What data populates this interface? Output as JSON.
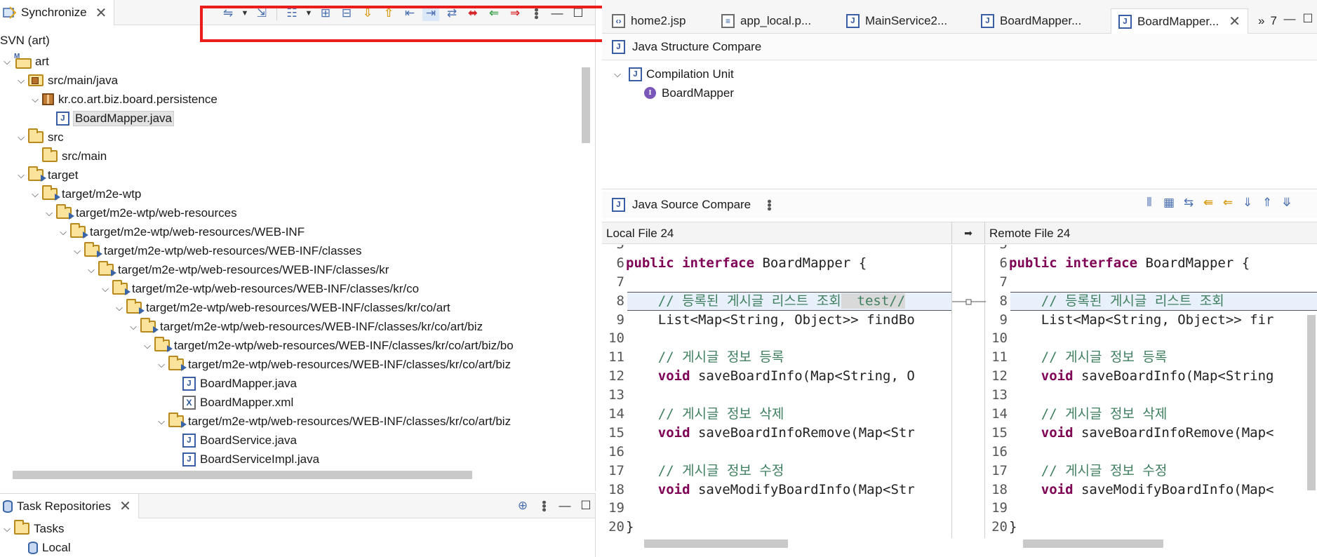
{
  "sync": {
    "tab_label": "Synchronize",
    "tree_title": "SVN (art)",
    "tree": [
      {
        "label": "art",
        "icon": "project-icon",
        "indent": 0,
        "expanded": true
      },
      {
        "label": "src/main/java",
        "icon": "package-folder-icon",
        "indent": 1,
        "expanded": true
      },
      {
        "label": "kr.co.art.biz.board.persistence",
        "icon": "package-icon",
        "indent": 2,
        "expanded": true
      },
      {
        "label": "BoardMapper.java",
        "icon": "java-file-icon",
        "indent": 3,
        "expanded": null,
        "selected": true
      },
      {
        "label": "src",
        "icon": "folder-icon",
        "indent": 1,
        "expanded": true
      },
      {
        "label": "src/main",
        "icon": "folder-icon",
        "indent": 2,
        "expanded": null
      },
      {
        "label": "target",
        "icon": "folder-outgoing-icon",
        "indent": 1,
        "expanded": true
      },
      {
        "label": "target/m2e-wtp",
        "icon": "folder-outgoing-icon",
        "indent": 2,
        "expanded": true
      },
      {
        "label": "target/m2e-wtp/web-resources",
        "icon": "folder-outgoing-icon",
        "indent": 3,
        "expanded": true
      },
      {
        "label": "target/m2e-wtp/web-resources/WEB-INF",
        "icon": "folder-outgoing-icon",
        "indent": 4,
        "expanded": true
      },
      {
        "label": "target/m2e-wtp/web-resources/WEB-INF/classes",
        "icon": "folder-outgoing-icon",
        "indent": 5,
        "expanded": true
      },
      {
        "label": "target/m2e-wtp/web-resources/WEB-INF/classes/kr",
        "icon": "folder-outgoing-icon",
        "indent": 6,
        "expanded": true
      },
      {
        "label": "target/m2e-wtp/web-resources/WEB-INF/classes/kr/co",
        "icon": "folder-outgoing-icon",
        "indent": 7,
        "expanded": true
      },
      {
        "label": "target/m2e-wtp/web-resources/WEB-INF/classes/kr/co/art",
        "icon": "folder-outgoing-icon",
        "indent": 8,
        "expanded": true
      },
      {
        "label": "target/m2e-wtp/web-resources/WEB-INF/classes/kr/co/art/biz",
        "icon": "folder-outgoing-icon",
        "indent": 9,
        "expanded": true
      },
      {
        "label": "target/m2e-wtp/web-resources/WEB-INF/classes/kr/co/art/biz/bo",
        "icon": "folder-outgoing-icon",
        "indent": 10,
        "expanded": true
      },
      {
        "label": "target/m2e-wtp/web-resources/WEB-INF/classes/kr/co/art/biz",
        "icon": "folder-outgoing-icon",
        "indent": 11,
        "expanded": true
      },
      {
        "label": "BoardMapper.java",
        "icon": "java-file-icon",
        "indent": 12,
        "expanded": null
      },
      {
        "label": "BoardMapper.xml",
        "icon": "xml-file-icon",
        "indent": 12,
        "expanded": null
      },
      {
        "label": "target/m2e-wtp/web-resources/WEB-INF/classes/kr/co/art/biz",
        "icon": "folder-outgoing-icon",
        "indent": 11,
        "expanded": true
      },
      {
        "label": "BoardService.java",
        "icon": "java-file-icon",
        "indent": 12,
        "expanded": null
      },
      {
        "label": "BoardServiceImpl.java",
        "icon": "java-file-icon",
        "indent": 12,
        "expanded": null
      }
    ]
  },
  "tasks": {
    "tab_label": "Task Repositories",
    "items": [
      {
        "label": "Tasks",
        "icon": "open-folder-icon",
        "expanded": true
      },
      {
        "label": "Local",
        "icon": "repository-icon",
        "expanded": null
      }
    ]
  },
  "editor_tabs": [
    {
      "label": "home2.jsp",
      "icon": "jsp-file-icon",
      "active": false
    },
    {
      "label": "app_local.p...",
      "icon": "properties-file-icon",
      "active": false
    },
    {
      "label": "MainService2...",
      "icon": "java-file-icon",
      "active": false
    },
    {
      "label": "BoardMapper...",
      "icon": "java-file-icon",
      "active": false
    },
    {
      "label": "BoardMapper...",
      "icon": "compare-icon",
      "active": true
    }
  ],
  "overflow_count": "7",
  "structure": {
    "title": "Java Structure Compare",
    "items": [
      {
        "label": "Compilation Unit",
        "icon": "compilation-unit-icon"
      },
      {
        "label": "BoardMapper",
        "icon": "interface-icon"
      }
    ]
  },
  "source": {
    "title": "Java Source Compare",
    "local_label": "Local File 24",
    "remote_label": "Remote File 24",
    "local_lines": [
      {
        "n": "5",
        "text": ""
      },
      {
        "n": "6",
        "kw": "public interface",
        "rest": " BoardMapper {"
      },
      {
        "n": "7",
        "text": ""
      },
      {
        "n": "8",
        "comment": "    // 등록된 게시글 리스트 조회",
        "extra": "  test//"
      },
      {
        "n": "9",
        "text": "    List<Map<String, Object>> findBo"
      },
      {
        "n": "10",
        "text": ""
      },
      {
        "n": "11",
        "comment": "    // 게시글 정보 등록"
      },
      {
        "n": "12",
        "kw": "    void",
        "rest": " saveBoardInfo(Map<String, O"
      },
      {
        "n": "13",
        "text": ""
      },
      {
        "n": "14",
        "comment": "    // 게시글 정보 삭제"
      },
      {
        "n": "15",
        "kw": "    void",
        "rest": " saveBoardInfoRemove(Map<Str"
      },
      {
        "n": "16",
        "text": ""
      },
      {
        "n": "17",
        "comment": "    // 게시글 정보 수정"
      },
      {
        "n": "18",
        "kw": "    void",
        "rest": " saveModifyBoardInfo(Map<Str"
      },
      {
        "n": "19",
        "text": ""
      },
      {
        "n": "20",
        "text": "}"
      }
    ],
    "remote_lines": [
      {
        "n": "5",
        "text": ""
      },
      {
        "n": "6",
        "kw": "public interface",
        "rest": " BoardMapper {"
      },
      {
        "n": "7",
        "text": ""
      },
      {
        "n": "8",
        "comment": "    // 등록된 게시글 리스트 조회"
      },
      {
        "n": "9",
        "text": "    List<Map<String, Object>> fir"
      },
      {
        "n": "10",
        "text": ""
      },
      {
        "n": "11",
        "comment": "    // 게시글 정보 등록"
      },
      {
        "n": "12",
        "kw": "    void",
        "rest": " saveBoardInfo(Map<String"
      },
      {
        "n": "13",
        "text": ""
      },
      {
        "n": "14",
        "comment": "    // 게시글 정보 삭제"
      },
      {
        "n": "15",
        "kw": "    void",
        "rest": " saveBoardInfoRemove(Map<"
      },
      {
        "n": "16",
        "text": ""
      },
      {
        "n": "17",
        "comment": "    // 게시글 정보 수정"
      },
      {
        "n": "18",
        "kw": "    void",
        "rest": " saveModifyBoardInfo(Map<"
      },
      {
        "n": "19",
        "text": ""
      },
      {
        "n": "20",
        "text": "}"
      }
    ]
  },
  "colors": {
    "highlight_box": "#ea1c1c",
    "keyword": "#7f0055",
    "comment": "#3f7f5f",
    "diff_background": "#e8f1fb"
  }
}
